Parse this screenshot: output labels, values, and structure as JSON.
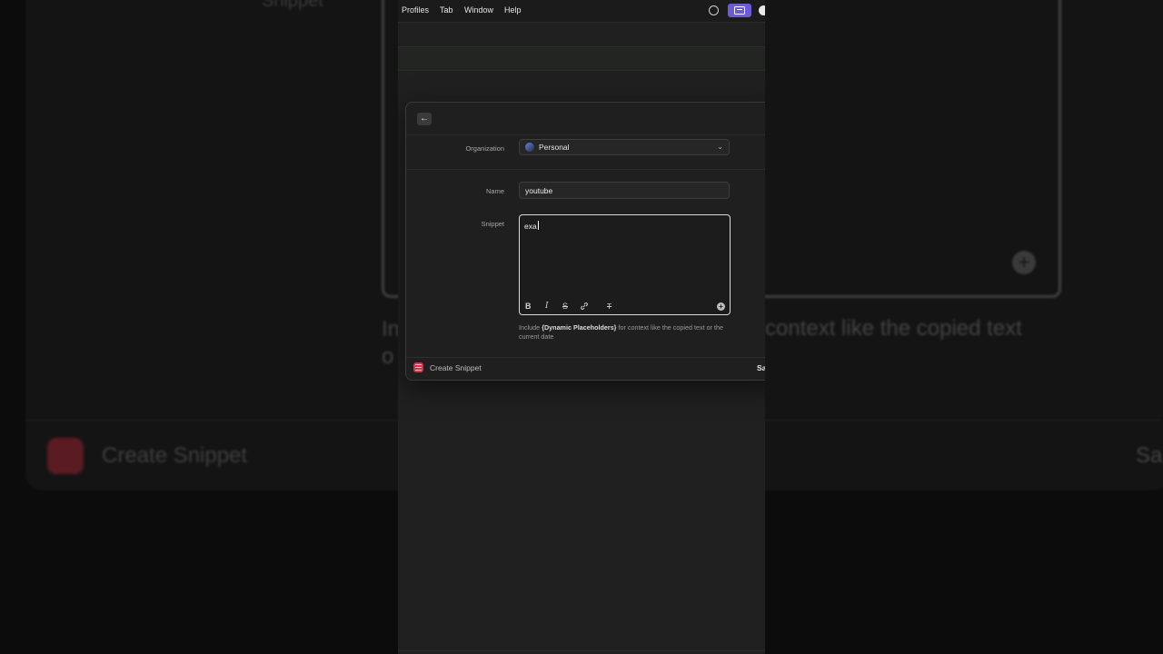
{
  "menubar": {
    "items": [
      "Profiles",
      "Tab",
      "Window",
      "Help"
    ]
  },
  "background": {
    "title": "Snippet",
    "hint_line1": "In",
    "hint_line2": "o",
    "hint_right": "context like the copied text",
    "create_label": "Create Snippet",
    "save_label": "Sa"
  },
  "dialog": {
    "organization_label": "Organization",
    "organization_value": "Personal",
    "name_label": "Name",
    "name_value": "youtube",
    "snippet_label": "Snippet",
    "snippet_value": "exa",
    "toolbar": {
      "bold": "B",
      "italic": "I",
      "strike": "S",
      "link": "🔗",
      "clear": "T"
    },
    "hint_prefix": "Include ",
    "hint_bold": "{Dynamic Placeholders}",
    "hint_suffix": " for context like the copied text or the current date",
    "footer_title": "Create Snippet",
    "footer_save": "Sa"
  },
  "colors": {
    "accent": "#6b5cd6",
    "logo": "#d0364a"
  }
}
